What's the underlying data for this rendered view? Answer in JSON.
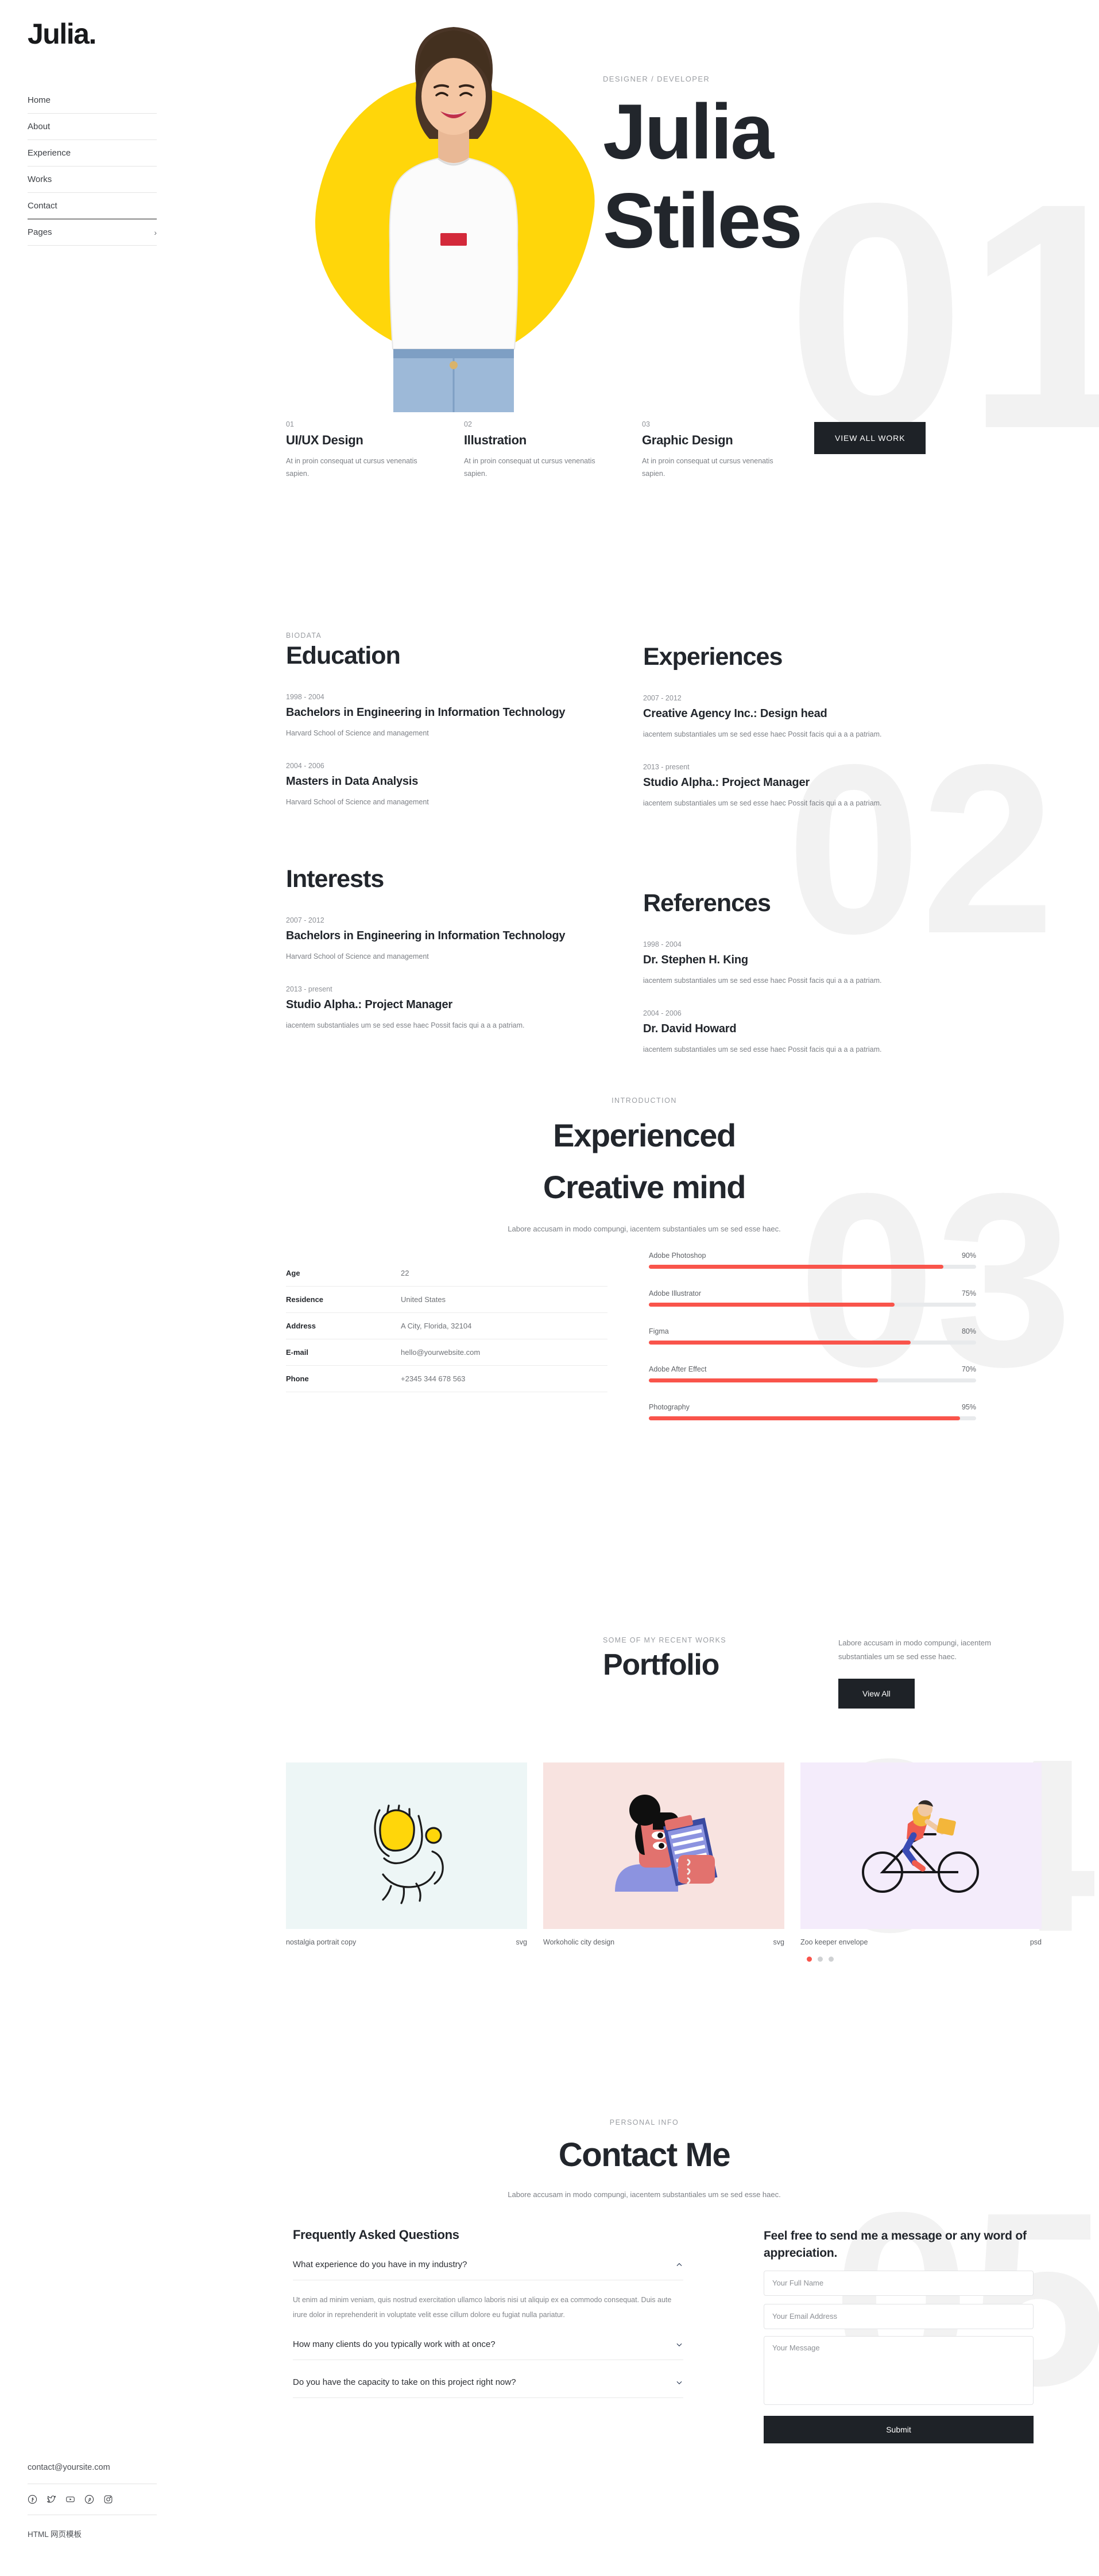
{
  "sidebar": {
    "logo": "Julia.",
    "nav": [
      {
        "label": "Home",
        "chevron": ""
      },
      {
        "label": "About",
        "chevron": ""
      },
      {
        "label": "Experience",
        "chevron": ""
      },
      {
        "label": "Works",
        "chevron": ""
      },
      {
        "label": "Contact",
        "chevron": ""
      },
      {
        "label": "Pages",
        "chevron": "›"
      }
    ],
    "footer": {
      "email": "contact@yoursite.com",
      "copyright": "HTML 网页模板",
      "social": [
        "facebook-icon",
        "twitter-icon",
        "youtube-icon",
        "pinterest-icon",
        "instagram-icon"
      ]
    }
  },
  "hero": {
    "eyebrow": "DESIGNER / DEVELOPER",
    "first_name": "Julia",
    "last_name": "Stiles",
    "cta": "VIEW ALL WORK",
    "ghost_number": "01",
    "blob_color": "#FFD60A",
    "services": [
      {
        "num": "01",
        "title": "UI/UX Design",
        "desc": "At in proin consequat ut cursus venenatis sapien."
      },
      {
        "num": "02",
        "title": "Illustration",
        "desc": "At in proin consequat ut cursus venenatis sapien."
      },
      {
        "num": "03",
        "title": "Graphic Design",
        "desc": "At in proin consequat ut cursus venenatis sapien."
      }
    ]
  },
  "resume": {
    "ghost_number": "02",
    "education": {
      "eyebrow": "BIODATA",
      "title": "Education",
      "entries": [
        {
          "date": "1998 - 2004",
          "title": "Bachelors in Engineering in Information Technology",
          "sub": "Harvard School of Science and management"
        },
        {
          "date": "2004 - 2006",
          "title": "Masters in Data Analysis",
          "sub": "Harvard School of Science and management"
        }
      ]
    },
    "experiences": {
      "title": "Experiences",
      "entries": [
        {
          "date": "2007 - 2012",
          "title": "Creative Agency Inc.: Design head",
          "sub": "iacentem substantiales um se sed esse haec Possit facis qui a a a patriam."
        },
        {
          "date": "2013 - present",
          "title": "Studio Alpha.: Project Manager",
          "sub": "iacentem substantiales um se sed esse haec Possit facis qui a a a patriam."
        }
      ]
    },
    "interests": {
      "title": "Interests",
      "entries": [
        {
          "date": "2007 - 2012",
          "title": "Bachelors in Engineering in Information Technology",
          "sub": "Harvard School of Science and management"
        },
        {
          "date": "2013 - present",
          "title": "Studio Alpha.: Project Manager",
          "sub": "iacentem substantiales um se sed esse haec Possit facis qui a a a patriam."
        }
      ]
    },
    "references": {
      "title": "References",
      "entries": [
        {
          "date": "1998 - 2004",
          "title": "Dr. Stephen H. King",
          "sub": "iacentem substantiales um se sed esse haec Possit facis qui a a a patriam."
        },
        {
          "date": "2004 - 2006",
          "title": "Dr. David Howard",
          "sub": "iacentem substantiales um se sed esse haec Possit facis qui a a a patriam."
        }
      ]
    }
  },
  "intro": {
    "ghost_number": "03",
    "eyebrow": "INTRODUCTION",
    "title_line1": "Experienced",
    "title_line2": "Creative mind",
    "lead": "Labore accusam in modo compungi, iacentem substantiales um se sed esse haec.",
    "info": [
      {
        "key": "Age",
        "value": "22"
      },
      {
        "key": "Residence",
        "value": "United States"
      },
      {
        "key": "Address",
        "value": "A City, Florida, 32104"
      },
      {
        "key": "E-mail",
        "value": "hello@yourwebsite.com"
      },
      {
        "key": "Phone",
        "value": "+2345 344 678 563"
      }
    ],
    "skills": [
      {
        "name": "Adobe Photoshop",
        "percent": "90%",
        "value": 90
      },
      {
        "name": "Adobe Illustrator",
        "percent": "75%",
        "value": 75
      },
      {
        "name": "Figma",
        "percent": "80%",
        "value": 80
      },
      {
        "name": "Adobe After Effect",
        "percent": "70%",
        "value": 70
      },
      {
        "name": "Photography",
        "percent": "95%",
        "value": 95
      }
    ],
    "skill_color": "#F9544B",
    "track_color": "#E8EAEC"
  },
  "portfolio": {
    "ghost_number": "04",
    "eyebrow": "SOME OF MY RECENT WORKS",
    "title": "Portfolio",
    "desc": "Labore accusam in modo compungi, iacentem substantiales um se sed esse haec.",
    "button": "View All",
    "items": [
      {
        "title": "nostalgia portrait copy",
        "format": "svg",
        "bg": "#EDF6F6",
        "art": "hands-illustration"
      },
      {
        "title": "Workoholic city design",
        "format": "svg",
        "bg": "#F8E3E0",
        "art": "person-clipboard-illustration"
      },
      {
        "title": "Zoo keeper envelope",
        "format": "psd",
        "bg": "#F4ECFB",
        "art": "cyclist-illustration"
      }
    ],
    "dots": 3,
    "active_dot": 0
  },
  "contact": {
    "ghost_number": "05",
    "eyebrow": "PERSONAL INFO",
    "title": "Contact Me",
    "lead": "Labore accusam in modo compungi, iacentem substantiales um se sed esse haec.",
    "faq_title": "Frequently Asked Questions",
    "faqs": [
      {
        "q": "What experience do you have in my industry?",
        "open": true,
        "a": "Ut enim ad minim veniam, quis nostrud exercitation ullamco laboris nisi ut aliquip ex ea commodo consequat. Duis aute irure dolor in reprehenderit in voluptate velit esse cillum dolore eu fugiat nulla pariatur."
      },
      {
        "q": "How many clients do you typically work with at once?",
        "open": false,
        "a": ""
      },
      {
        "q": "Do you have the capacity to take on this project right now?",
        "open": false,
        "a": ""
      }
    ],
    "form": {
      "title": "Feel free to send me a message or any word of appreciation.",
      "name_placeholder": "Your Full Name",
      "email_placeholder": "Your Email Address",
      "message_placeholder": "Your Message",
      "submit": "Submit"
    }
  }
}
